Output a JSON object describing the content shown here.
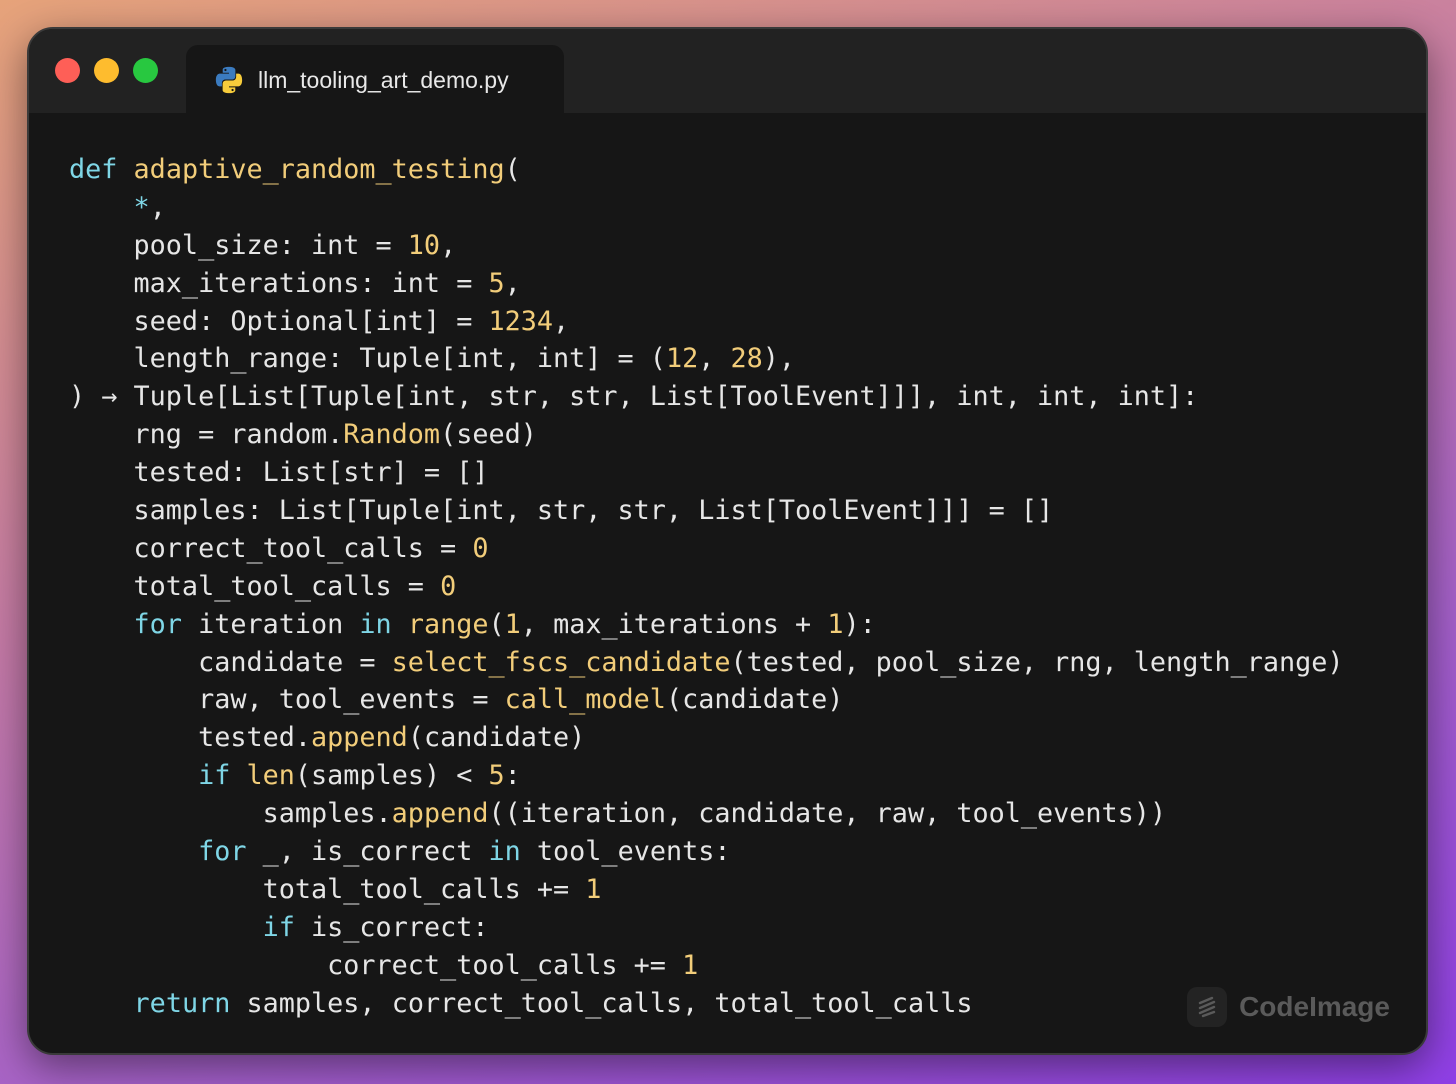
{
  "window": {
    "tab_title": "llm_tooling_art_demo.py",
    "tab_icon": "python-icon"
  },
  "code": {
    "lines": [
      [
        {
          "t": "def",
          "c": "kw"
        },
        {
          "t": " "
        },
        {
          "t": "adaptive_random_testing",
          "c": "fn"
        },
        {
          "t": "("
        }
      ],
      [
        {
          "t": "    "
        },
        {
          "t": "*",
          "c": "kw"
        },
        {
          "t": ","
        }
      ],
      [
        {
          "t": "    pool_size: int = "
        },
        {
          "t": "10",
          "c": "num"
        },
        {
          "t": ","
        }
      ],
      [
        {
          "t": "    max_iterations: int = "
        },
        {
          "t": "5",
          "c": "num"
        },
        {
          "t": ","
        }
      ],
      [
        {
          "t": "    seed: Optional[int] = "
        },
        {
          "t": "1234",
          "c": "num"
        },
        {
          "t": ","
        }
      ],
      [
        {
          "t": "    length_range: Tuple[int, int] = ("
        },
        {
          "t": "12",
          "c": "num"
        },
        {
          "t": ", "
        },
        {
          "t": "28",
          "c": "num"
        },
        {
          "t": "),"
        }
      ],
      [
        {
          "t": ") → Tuple[List[Tuple[int, str, str, List[ToolEvent]]], int, int, int]:"
        }
      ],
      [
        {
          "t": "    rng = random."
        },
        {
          "t": "Random",
          "c": "fn"
        },
        {
          "t": "(seed)"
        }
      ],
      [
        {
          "t": "    tested: List[str] = []"
        }
      ],
      [
        {
          "t": "    samples: List[Tuple[int, str, str, List[ToolEvent]]] = []"
        }
      ],
      [
        {
          "t": "    correct_tool_calls = "
        },
        {
          "t": "0",
          "c": "num"
        }
      ],
      [
        {
          "t": "    total_tool_calls = "
        },
        {
          "t": "0",
          "c": "num"
        }
      ],
      [
        {
          "t": "    "
        },
        {
          "t": "for",
          "c": "kw"
        },
        {
          "t": " iteration "
        },
        {
          "t": "in",
          "c": "kw"
        },
        {
          "t": " "
        },
        {
          "t": "range",
          "c": "fn"
        },
        {
          "t": "("
        },
        {
          "t": "1",
          "c": "num"
        },
        {
          "t": ", max_iterations + "
        },
        {
          "t": "1",
          "c": "num"
        },
        {
          "t": "):"
        }
      ],
      [
        {
          "t": "        candidate = "
        },
        {
          "t": "select_fscs_candidate",
          "c": "fn"
        },
        {
          "t": "(tested, pool_size, rng, length_range)"
        }
      ],
      [
        {
          "t": "        raw, tool_events = "
        },
        {
          "t": "call_model",
          "c": "fn"
        },
        {
          "t": "(candidate)"
        }
      ],
      [
        {
          "t": "        tested."
        },
        {
          "t": "append",
          "c": "fn"
        },
        {
          "t": "(candidate)"
        }
      ],
      [
        {
          "t": "        "
        },
        {
          "t": "if",
          "c": "kw"
        },
        {
          "t": " "
        },
        {
          "t": "len",
          "c": "fn"
        },
        {
          "t": "(samples) < "
        },
        {
          "t": "5",
          "c": "num"
        },
        {
          "t": ":"
        }
      ],
      [
        {
          "t": "            samples."
        },
        {
          "t": "append",
          "c": "fn"
        },
        {
          "t": "((iteration, candidate, raw, tool_events))"
        }
      ],
      [
        {
          "t": "        "
        },
        {
          "t": "for",
          "c": "kw"
        },
        {
          "t": " _, is_correct "
        },
        {
          "t": "in",
          "c": "kw"
        },
        {
          "t": " tool_events:"
        }
      ],
      [
        {
          "t": "            total_tool_calls += "
        },
        {
          "t": "1",
          "c": "num"
        }
      ],
      [
        {
          "t": "            "
        },
        {
          "t": "if",
          "c": "kw"
        },
        {
          "t": " is_correct:"
        }
      ],
      [
        {
          "t": "                correct_tool_calls += "
        },
        {
          "t": "1",
          "c": "num"
        }
      ],
      [
        {
          "t": "    "
        },
        {
          "t": "return",
          "c": "kw"
        },
        {
          "t": " samples, correct_tool_calls, total_tool_calls"
        }
      ]
    ]
  },
  "watermark": {
    "label": "CodeImage",
    "icon": "codeimage-logo-icon"
  },
  "colors": {
    "keyword": "#7fd6e6",
    "function": "#f2cd7a",
    "number": "#f2cd7a",
    "text": "#e6e6e6",
    "editor_bg": "#161616"
  }
}
